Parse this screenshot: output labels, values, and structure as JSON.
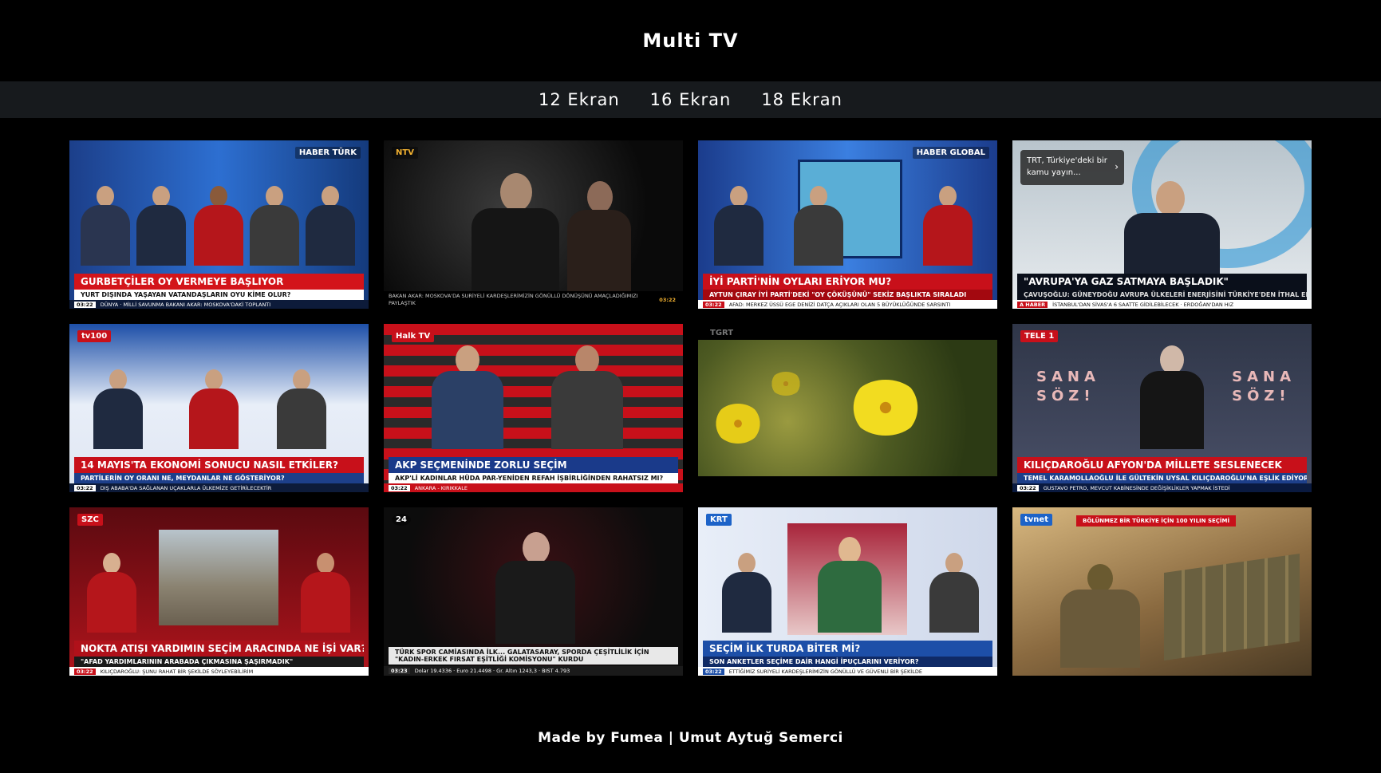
{
  "app": {
    "title": "Multi TV"
  },
  "nav": [
    {
      "label": "12 Ekran"
    },
    {
      "label": "16 Ekran"
    },
    {
      "label": "18 Ekran"
    }
  ],
  "tiles": [
    {
      "channel": "HABER TÜRK",
      "headline": "GURBETÇİLER OY VERMEYE BAŞLIYOR",
      "sub": "YURT DIŞINDA YAŞAYAN VATANDAŞLARIN OYU KİME OLUR?",
      "clock": "03:22",
      "ticker": "DÜNYA · MİLLİ SAVUNMA BAKANI AKAR: MOSKOVA'DAKİ TOPLANTI"
    },
    {
      "channel": "NTV",
      "headline": "",
      "sub": "BAKAN AKAR: MOSKOVA'DA SURİYELİ KARDEŞLERİMİZİN GÖNÜLLÜ DÖNÜŞÜNÜ AMAÇLADIĞIMIZI PAYLAŞTIK",
      "clock": "03:22",
      "ticker": ""
    },
    {
      "channel": "HABER GLOBAL",
      "headline": "İYİ PARTİ'NİN OYLARI ERİYOR MU?",
      "sub": "AYTUN ÇIRAY İYİ PARTİ'DEKİ \"OY ÇÖKÜŞÜNÜ\" SEKİZ BAŞLIKTA SIRALADI",
      "clock": "03:22",
      "ticker": "AFAD: MERKEZ ÜSSÜ EGE DENİZİ DATÇA AÇIKLARI OLAN 5 BÜYÜKLÜĞÜNDE SARSINTI"
    },
    {
      "channel": "A HABER",
      "headline": "\"AVRUPA'YA GAZ SATMAYA BAŞLADIK\"",
      "sub": "ÇAVUŞOĞLU: GÜNEYDOĞU AVRUPA ÜLKELERİ ENERJİSİNİ TÜRKİYE'DEN İTHAL EDİYOR",
      "clock": "",
      "ticker": "İSTANBUL'DAN SİVAS'A 6 SAATTE GİDİLEBİLECEK · ERDOĞAN'DAN HIZ",
      "popup": "TRT, Türkiye'deki bir kamu yayın..."
    },
    {
      "channel": "tv100",
      "headline": "14 MAYIS'TA EKONOMİ SONUCU NASIL ETKİLER?",
      "sub": "PARTİLERİN OY ORANI NE, MEYDANLAR NE GÖSTERİYOR?",
      "clock": "03:22",
      "ticker": "DIŞ ABABA'DA SAĞLANAN UÇAKLARLA ÜLKEMİZE GETİRİLECEKTİR"
    },
    {
      "channel": "Halk TV",
      "headline": "AKP SEÇMENİNDE ZORLU SEÇİM",
      "sub": "AKP'Lİ KADINLAR HÜDA PAR-YENİDEN REFAH İŞBİRLİĞİNDEN RAHATSIZ MI?",
      "clock": "03:22",
      "ticker": "ANKARA - KIRIKKALE"
    },
    {
      "channel": "TGRT",
      "headline": "",
      "sub": "",
      "clock": "",
      "ticker": ""
    },
    {
      "channel": "TELE 1",
      "headline": "KILIÇDAROĞLU AFYON'DA MİLLETE SESLENECEK",
      "sub": "TEMEL KARAMOLLAOĞLU İLE GÜLTEKİN UYSAL KILIÇDAROĞLU'NA EŞLİK EDİYOR",
      "clock": "03:22",
      "ticker": "GUSTAVO PETRO, MEVCUT KABİNESİNDE DEĞİŞİKLİKLER YAPMAK İSTEDİ"
    },
    {
      "channel": "SZC",
      "headline": "NOKTA ATIŞI YARDIMIN SEÇİM ARACINDA NE İŞİ VAR?",
      "sub": "\"AFAD YARDIMLARININ ARABADA ÇIKMASINA ŞAŞIRMADIK\"",
      "clock": "03:22",
      "ticker": "KILIÇDAROĞLU: ŞUNU RAHAT BİR ŞEKİLDE SÖYLEYEBİLİRİM"
    },
    {
      "channel": "24",
      "headline": "",
      "sub": "TÜRK SPOR CAMİASINDA İLK... GALATASARAY, SPORDA ÇEŞİTLİLİK İÇİN \"KADIN-ERKEK FIRSAT EŞİTLİĞİ KOMİSYONU\" KURDU",
      "clock": "03:23",
      "ticker": "Dolar 19.4336 · Euro 21.4498 · Gr. Altın 1243,3 · BIST 4.793"
    },
    {
      "channel": "KRT",
      "headline": "SEÇİM İLK TURDA BİTER Mİ?",
      "sub": "SON ANKETLER SEÇİME DAİR HANGİ İPUÇLARINI VERİYOR?",
      "clock": "03:22",
      "ticker": "ETTİĞİMİZ SURİYELİ KARDEŞLERİMİZİN GÖNÜLLÜ VE GÜVENLİ BİR ŞEKİLDE"
    },
    {
      "channel": "tvnet",
      "headline": "",
      "sub": "",
      "clock": "",
      "ticker": "BÖLÜNMEZ BİR TÜRKİYE İÇİN 100 YILIN SEÇİMİ"
    }
  ],
  "footer": {
    "text": "Made by Fumea | Umut Aytuğ Semerci"
  }
}
